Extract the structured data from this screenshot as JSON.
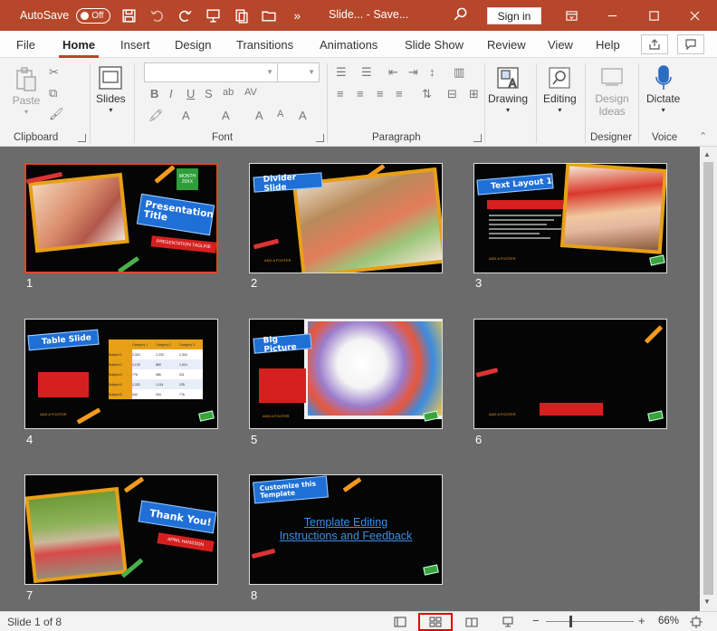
{
  "titlebar": {
    "autosave_label": "AutoSave",
    "autosave_state": "Off",
    "title": "Slide... - Save...",
    "signin_label": "Sign in"
  },
  "tabs": [
    {
      "label": "File"
    },
    {
      "label": "Home"
    },
    {
      "label": "Insert"
    },
    {
      "label": "Design"
    },
    {
      "label": "Transitions"
    },
    {
      "label": "Animations"
    },
    {
      "label": "Slide Show"
    },
    {
      "label": "Review"
    },
    {
      "label": "View"
    },
    {
      "label": "Help"
    }
  ],
  "ribbon": {
    "paste_label": "Paste",
    "slides_label": "Slides",
    "drawing_label": "Drawing",
    "editing_label": "Editing",
    "design_ideas_label": "Design Ideas",
    "dictate_label": "Dictate",
    "groups": {
      "clipboard": "Clipboard",
      "font": "Font",
      "paragraph": "Paragraph",
      "designer": "Designer",
      "voice": "Voice"
    }
  },
  "slides": [
    {
      "number": "1",
      "title": "Presentation Title",
      "subtitle": "PRESENTATION TAGLINE",
      "badge": "MONTH 20XX"
    },
    {
      "number": "2",
      "title": "Divider Slide",
      "footer": "ADD A FOOTER"
    },
    {
      "number": "3",
      "title": "Text Layout 1",
      "footer": "ADD A FOOTER"
    },
    {
      "number": "4",
      "title": "Table Slide",
      "footer": "ADD A FOOTER",
      "table_headers": [
        "Category 1",
        "Category 2",
        "Category 3"
      ],
      "table_rows": [
        {
          "label": "Subject 1",
          "cells": [
            "2,324",
            "2,233",
            "2,324"
          ]
        },
        {
          "label": "Subject 2",
          "cells": [
            "1,133",
            "860",
            "1,014"
          ]
        },
        {
          "label": "Subject 3",
          "cells": [
            "776",
            "386",
            "311"
          ]
        },
        {
          "label": "Subject 4",
          "cells": [
            "1,322",
            "1,114",
            "225"
          ]
        },
        {
          "label": "Subject 5",
          "cells": [
            "342",
            "334",
            "776"
          ]
        }
      ]
    },
    {
      "number": "5",
      "title": "Big Picture",
      "footer": "ADD A FOOTER"
    },
    {
      "number": "6",
      "footer": "ADD A FOOTER"
    },
    {
      "number": "7",
      "title": "Thank You!",
      "subtitle": "APRIL HANSSON"
    },
    {
      "number": "8",
      "title": "Customize this Template",
      "link1": "Template Editing",
      "link2": "Instructions and Feedback"
    }
  ],
  "statusbar": {
    "slide_counter": "Slide 1 of 8",
    "zoom_minus": "−",
    "zoom_plus": "+",
    "zoom_percent": "66%"
  },
  "colors": {
    "brand": "#b7472a",
    "ribbon_bg": "#f3f3f3",
    "sorter_bg": "#6b6b6b",
    "selection": "#e0462c",
    "slide_banner_blue": "#1f6fd6",
    "slide_banner_red": "#d62020",
    "frame_orange": "#e8a017"
  }
}
